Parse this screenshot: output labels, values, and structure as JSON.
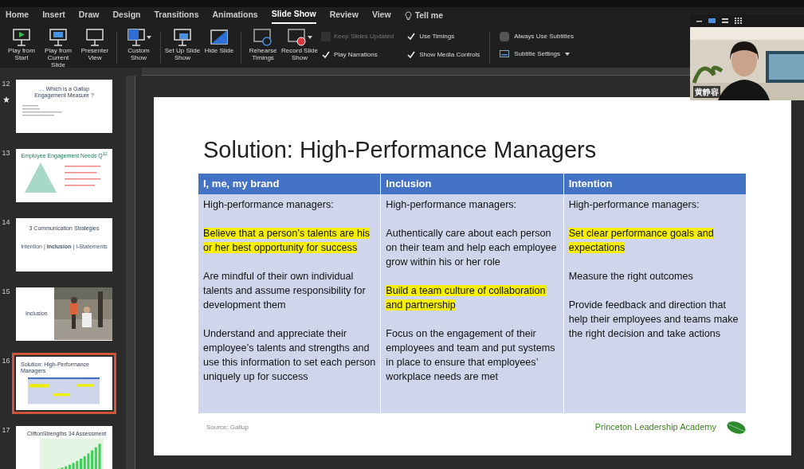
{
  "menu_tabs": [
    {
      "label": "Home",
      "selected": false
    },
    {
      "label": "Insert",
      "selected": false
    },
    {
      "label": "Draw",
      "selected": false
    },
    {
      "label": "Design",
      "selected": false
    },
    {
      "label": "Transitions",
      "selected": false
    },
    {
      "label": "Animations",
      "selected": false
    },
    {
      "label": "Slide Show",
      "selected": true
    },
    {
      "label": "Review",
      "selected": false
    },
    {
      "label": "View",
      "selected": false
    }
  ],
  "tell_me": "Tell me",
  "ribbon_buttons": [
    {
      "kind": "play",
      "label": "Play from Start",
      "caret": false
    },
    {
      "kind": "play-current",
      "label": "Play from Current Slide",
      "caret": false
    },
    {
      "kind": "presenter",
      "label": "Presenter View",
      "caret": false
    },
    {
      "kind": "custom",
      "label": "Custom Show",
      "caret": true
    },
    {
      "kind": "setup",
      "label": "Set Up Slide Show",
      "caret": false
    },
    {
      "kind": "hide",
      "label": "Hide Slide",
      "caret": false
    },
    {
      "kind": "rehearse",
      "label": "Rehearse Timings",
      "caret": false
    },
    {
      "kind": "record",
      "label": "Record Slide Show",
      "caret": true
    }
  ],
  "ribbon_options": [
    {
      "label": "Keep Slides Updated",
      "checked": false,
      "disabled": true
    },
    {
      "label": "Play Narrations",
      "checked": true,
      "disabled": false
    },
    {
      "label": "Use Timings",
      "checked": true,
      "disabled": false
    },
    {
      "label": "Show Media Controls",
      "checked": true,
      "disabled": false
    }
  ],
  "subtitles": {
    "always_label": "Always Use Subtitles",
    "checked": false,
    "settings_label": "Subtitle Settings"
  },
  "thumbnails": [
    {
      "number": "12",
      "kind": "text",
      "starred": true,
      "selected": false,
      "title": "… Which is a Gallup Engagement Measure ?"
    },
    {
      "number": "13",
      "kind": "pyramid",
      "starred": false,
      "selected": false,
      "title": "Employee Engagement Needs Q$^{12}$"
    },
    {
      "number": "14",
      "kind": "strategies",
      "starred": false,
      "selected": false,
      "title": "3 Communication Strategies",
      "subtitle": "Intention | **Inclusion** | I-Statements"
    },
    {
      "number": "15",
      "starred": false,
      "selected": false,
      "title": "Inclusion"
    },
    {
      "number": "16",
      "kind": "table",
      "starred": false,
      "selected": true,
      "title": "Solution: High-Performance Managers"
    },
    {
      "number": "17",
      "kind": "chart",
      "starred": false,
      "selected": false,
      "title": "CliftonStrengths 34 Assessment"
    }
  ],
  "slide": {
    "title": "Solution: High-Performance Managers",
    "columns": [
      {
        "heading": "I, me, my brand",
        "paragraphs": [
          {
            "text": "High-performance managers:",
            "highlighted": false
          },
          {
            "text": "Believe that a person’s talents are his or her best opportunity for success",
            "highlighted": true
          },
          {
            "text": "Are mindful of their own individual talents and assume responsibility for development them",
            "highlighted": false
          },
          {
            "text": "Understand and appreciate their employee’s talents and strengths and use this information to set each person uniquely up for success",
            "highlighted": false
          }
        ]
      },
      {
        "heading": "Inclusion",
        "paragraphs": [
          {
            "text": "High-performance managers:",
            "highlighted": false
          },
          {
            "text": "Authentically care about each person on their team and help each employee grow within his or her role",
            "highlighted": false
          },
          {
            "text": "Build a team culture of collaboration and partnership",
            "highlighted": true
          },
          {
            "text": "Focus on the engagement of their employees and team and put systems in place to ensure that employees’ workplace needs are met",
            "highlighted": false
          }
        ]
      },
      {
        "heading": "Intention",
        "paragraphs": [
          {
            "text": "High-performance managers:",
            "highlighted": false
          },
          {
            "text": "Set clear performance goals and expectations",
            "highlighted": true
          },
          {
            "text": "Measure the right outcomes",
            "highlighted": false
          },
          {
            "text": "Provide feedback and direction that help their employees and teams make the right decision and take actions",
            "highlighted": false
          }
        ]
      }
    ],
    "source": "Source: Gallup",
    "brand": "Princeton Leadership Academy"
  },
  "video": {
    "name": "黄静容"
  }
}
